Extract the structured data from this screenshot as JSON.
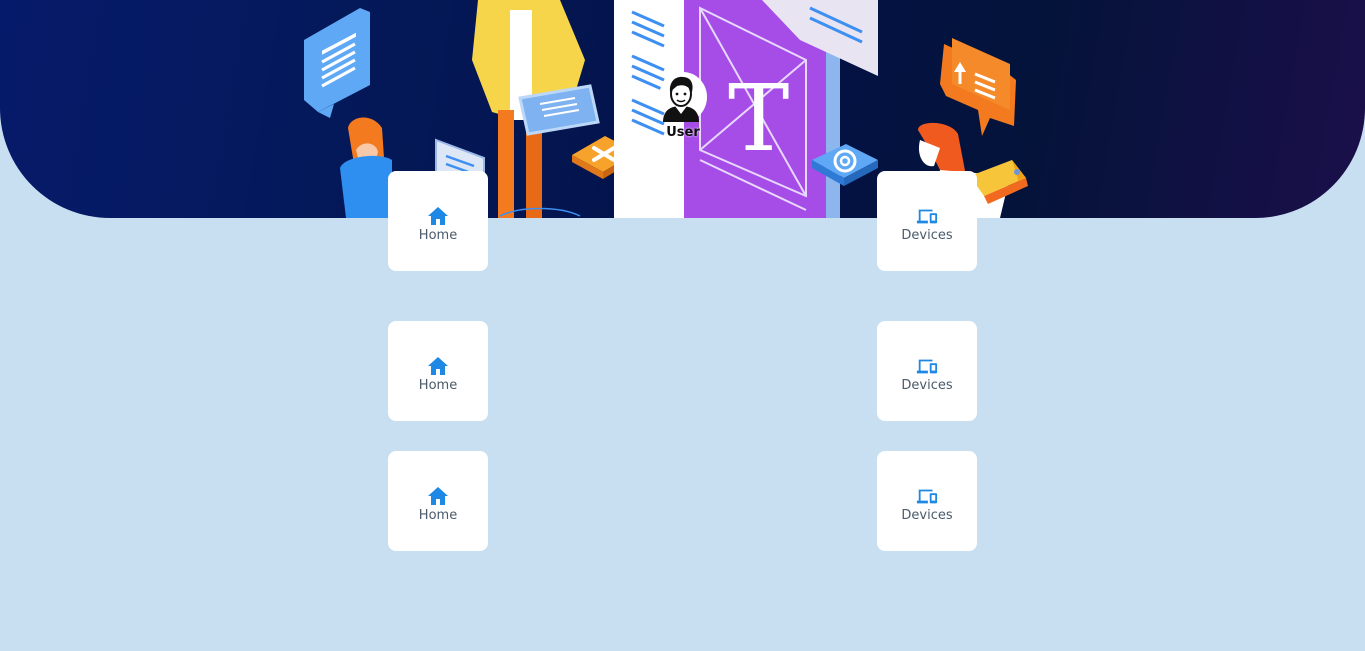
{
  "user": {
    "label": "User",
    "icon": "user-avatar-icon"
  },
  "tiles": [
    {
      "label": "Home",
      "icon": "home-icon"
    },
    {
      "label": "Devices",
      "icon": "devices-icon"
    },
    {
      "label": "Home",
      "icon": "home-icon"
    },
    {
      "label": "Devices",
      "icon": "devices-icon"
    },
    {
      "label": "Home",
      "icon": "home-icon"
    },
    {
      "label": "Devices",
      "icon": "devices-icon"
    }
  ],
  "colors": {
    "background": "#c8dff2",
    "banner_dark": "#031247",
    "accent": "#1e88e5",
    "tile": "#ffffff"
  }
}
